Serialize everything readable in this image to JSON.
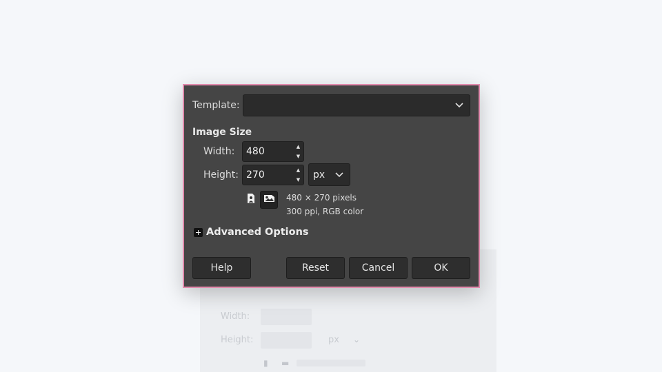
{
  "background_window": {
    "fields": [
      "Width:",
      "Height:",
      "px"
    ]
  },
  "dialog": {
    "template": {
      "label": "Template:",
      "value": ""
    },
    "image_size": {
      "title": "Image Size",
      "width_label": "Width:",
      "width_value": "480",
      "height_label": "Height:",
      "height_value": "270",
      "unit": "px",
      "portrait_icon": "portrait-orientation-icon",
      "landscape_icon": "landscape-orientation-icon",
      "active_orientation": "landscape",
      "info_line1": "480 × 270 pixels",
      "info_line2": "300 ppi, RGB color"
    },
    "advanced": {
      "label": "Advanced Options",
      "expanded": false
    },
    "buttons": {
      "help": "Help",
      "reset": "Reset",
      "cancel": "Cancel",
      "ok": "OK"
    }
  },
  "colors": {
    "dialog_bg": "#454545",
    "dialog_border": "#e28aad",
    "field_bg": "#2b2b2b",
    "page_bg": "#f5f7fa"
  }
}
